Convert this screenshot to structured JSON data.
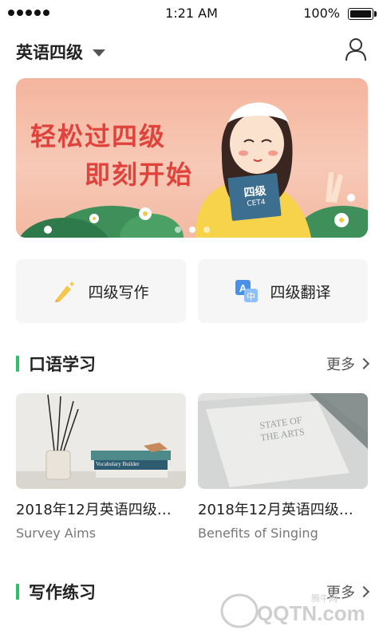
{
  "status_bar": {
    "time": "1:21 AM",
    "battery": "100%",
    "battery_level": 1.0
  },
  "header": {
    "level": "英语四级",
    "user_icon": "user-icon"
  },
  "banner": {
    "line1": "轻松过四级",
    "line2": "即刻开始",
    "book_text": "四级",
    "book_subtext": "CET4",
    "slide_count": 3,
    "active_slide": 1
  },
  "quick_actions": [
    {
      "label": "四级写作",
      "icon": "pencil-sparkle-icon"
    },
    {
      "label": "四级翻译",
      "icon": "translate-icon"
    }
  ],
  "sections": {
    "speaking": {
      "title": "口语学习",
      "more": "更多",
      "items": [
        {
          "title": "2018年12月英语四级…",
          "subtitle": "Survey Aims"
        },
        {
          "title": "2018年12月英语四级…",
          "subtitle": "Benefits of Singing"
        }
      ]
    },
    "writing": {
      "title": "写作练习",
      "more": "更多"
    }
  },
  "thumbnails": {
    "book_spine_1": "Vocabulary Builder",
    "magazine_text": "STATE OF THE ARTS"
  },
  "watermark": {
    "brand": "QQTN.com",
    "sub": "腾牛网"
  },
  "colors": {
    "accent_green": "#2fbf6a",
    "banner_red": "#e0433c",
    "banner_bg": "#f4b59e"
  }
}
